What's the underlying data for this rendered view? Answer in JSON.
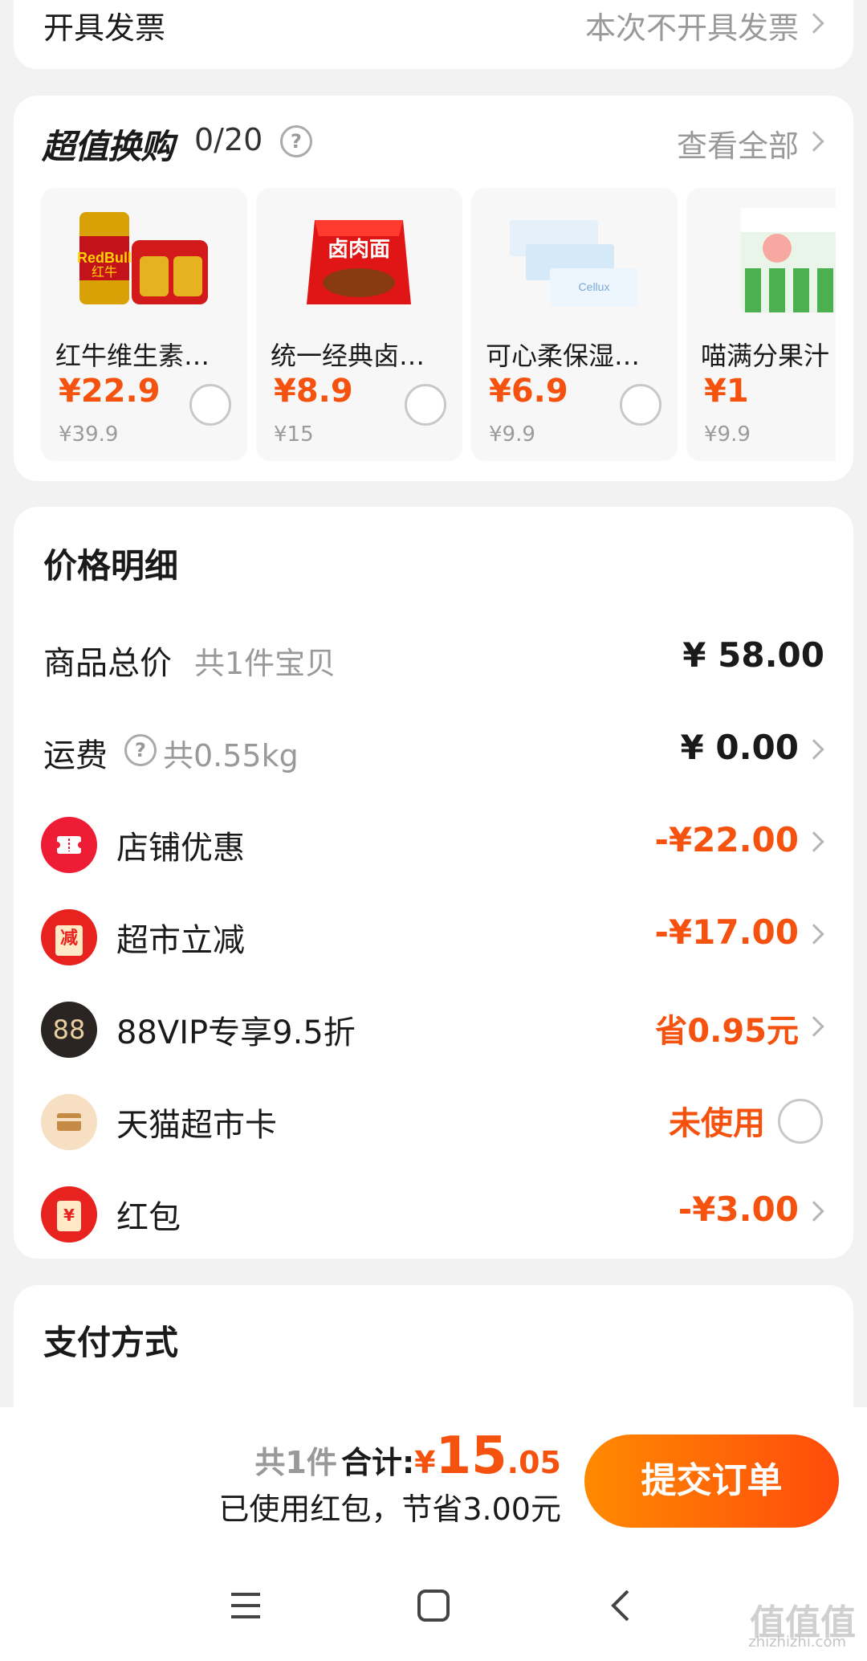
{
  "invoice": {
    "label": "开具发票",
    "value": "本次不开具发票"
  },
  "exchange": {
    "title": "超值换购",
    "count": "0/20",
    "view_all": "查看全部",
    "products": [
      {
        "name": "红牛维生素…",
        "price": "¥22.9",
        "original": "¥39.9",
        "icon": "red-bull-can-image"
      },
      {
        "name": "统一经典卤…",
        "price": "¥8.9",
        "original": "¥15",
        "icon": "instant-noodle-pack-image"
      },
      {
        "name": "可心柔保湿…",
        "price": "¥6.9",
        "original": "¥9.9",
        "icon": "tissue-pack-image"
      },
      {
        "name": "喵满分果汁",
        "price": "¥1",
        "original": "¥9.9",
        "icon": "juice-jelly-image"
      }
    ]
  },
  "price_detail": {
    "title": "价格明细",
    "goods_total": {
      "label": "商品总价",
      "sub": "共1件宝贝",
      "value": "¥ 58.00"
    },
    "shipping": {
      "label": "运费",
      "sub": "共0.55kg",
      "value": "¥ 0.00"
    },
    "discounts": [
      {
        "label": "店铺优惠",
        "value": "-¥22.00",
        "icon": "ticket-icon",
        "icon_text": ""
      },
      {
        "label": "超市立减",
        "value": "-¥17.00",
        "icon": "reduce-icon",
        "icon_text": "减"
      },
      {
        "label": "88VIP专享9.5折",
        "value": "省0.95元",
        "icon": "vip88-icon",
        "icon_text": "88"
      },
      {
        "label": "天猫超市卡",
        "value": "未使用",
        "icon": "card-icon",
        "icon_text": ""
      },
      {
        "label": "红包",
        "value": "-¥3.00",
        "icon": "red-packet-icon",
        "icon_text": "¥"
      }
    ]
  },
  "payment": {
    "title": "支付方式"
  },
  "footer": {
    "count": "共1件",
    "total_label": "合计:",
    "currency": "¥",
    "total_int": "15",
    "total_dec": ".05",
    "saved": "已使用红包，节省3.00元",
    "submit": "提交订单"
  },
  "watermark": {
    "text": "值值值",
    "sub": "zhizhizhi.com"
  },
  "colors": {
    "accent": "#f5520f",
    "button_start": "#ff8a00",
    "button_end": "#ff4b0c"
  }
}
